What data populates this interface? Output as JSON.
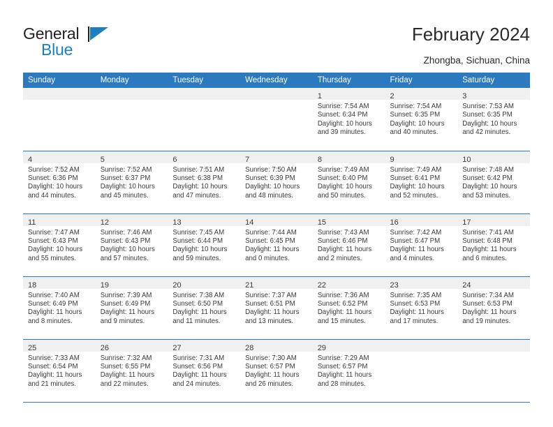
{
  "brand": {
    "name_top": "General",
    "name_bottom": "Blue",
    "accent_color": "#1b7fc4"
  },
  "header": {
    "title": "February 2024",
    "subtitle": "Zhongba, Sichuan, China",
    "header_bg": "#2b7ac0",
    "cell_band_bg": "#f0f0f0"
  },
  "weekdays": [
    "Sunday",
    "Monday",
    "Tuesday",
    "Wednesday",
    "Thursday",
    "Friday",
    "Saturday"
  ],
  "labels": {
    "sunrise_prefix": "Sunrise:",
    "sunset_prefix": "Sunset:",
    "daylight_prefix": "Daylight:"
  },
  "weeks": [
    [
      {
        "day": "",
        "lines": [
          "",
          "",
          "",
          ""
        ]
      },
      {
        "day": "",
        "lines": [
          "",
          "",
          "",
          ""
        ]
      },
      {
        "day": "",
        "lines": [
          "",
          "",
          "",
          ""
        ]
      },
      {
        "day": "",
        "lines": [
          "",
          "",
          "",
          ""
        ]
      },
      {
        "day": "1",
        "lines": [
          "Sunrise: 7:54 AM",
          "Sunset: 6:34 PM",
          "Daylight: 10 hours",
          "and 39 minutes."
        ]
      },
      {
        "day": "2",
        "lines": [
          "Sunrise: 7:54 AM",
          "Sunset: 6:35 PM",
          "Daylight: 10 hours",
          "and 40 minutes."
        ]
      },
      {
        "day": "3",
        "lines": [
          "Sunrise: 7:53 AM",
          "Sunset: 6:35 PM",
          "Daylight: 10 hours",
          "and 42 minutes."
        ]
      }
    ],
    [
      {
        "day": "4",
        "lines": [
          "Sunrise: 7:52 AM",
          "Sunset: 6:36 PM",
          "Daylight: 10 hours",
          "and 44 minutes."
        ]
      },
      {
        "day": "5",
        "lines": [
          "Sunrise: 7:52 AM",
          "Sunset: 6:37 PM",
          "Daylight: 10 hours",
          "and 45 minutes."
        ]
      },
      {
        "day": "6",
        "lines": [
          "Sunrise: 7:51 AM",
          "Sunset: 6:38 PM",
          "Daylight: 10 hours",
          "and 47 minutes."
        ]
      },
      {
        "day": "7",
        "lines": [
          "Sunrise: 7:50 AM",
          "Sunset: 6:39 PM",
          "Daylight: 10 hours",
          "and 48 minutes."
        ]
      },
      {
        "day": "8",
        "lines": [
          "Sunrise: 7:49 AM",
          "Sunset: 6:40 PM",
          "Daylight: 10 hours",
          "and 50 minutes."
        ]
      },
      {
        "day": "9",
        "lines": [
          "Sunrise: 7:49 AM",
          "Sunset: 6:41 PM",
          "Daylight: 10 hours",
          "and 52 minutes."
        ]
      },
      {
        "day": "10",
        "lines": [
          "Sunrise: 7:48 AM",
          "Sunset: 6:42 PM",
          "Daylight: 10 hours",
          "and 53 minutes."
        ]
      }
    ],
    [
      {
        "day": "11",
        "lines": [
          "Sunrise: 7:47 AM",
          "Sunset: 6:43 PM",
          "Daylight: 10 hours",
          "and 55 minutes."
        ]
      },
      {
        "day": "12",
        "lines": [
          "Sunrise: 7:46 AM",
          "Sunset: 6:43 PM",
          "Daylight: 10 hours",
          "and 57 minutes."
        ]
      },
      {
        "day": "13",
        "lines": [
          "Sunrise: 7:45 AM",
          "Sunset: 6:44 PM",
          "Daylight: 10 hours",
          "and 59 minutes."
        ]
      },
      {
        "day": "14",
        "lines": [
          "Sunrise: 7:44 AM",
          "Sunset: 6:45 PM",
          "Daylight: 11 hours",
          "and 0 minutes."
        ]
      },
      {
        "day": "15",
        "lines": [
          "Sunrise: 7:43 AM",
          "Sunset: 6:46 PM",
          "Daylight: 11 hours",
          "and 2 minutes."
        ]
      },
      {
        "day": "16",
        "lines": [
          "Sunrise: 7:42 AM",
          "Sunset: 6:47 PM",
          "Daylight: 11 hours",
          "and 4 minutes."
        ]
      },
      {
        "day": "17",
        "lines": [
          "Sunrise: 7:41 AM",
          "Sunset: 6:48 PM",
          "Daylight: 11 hours",
          "and 6 minutes."
        ]
      }
    ],
    [
      {
        "day": "18",
        "lines": [
          "Sunrise: 7:40 AM",
          "Sunset: 6:49 PM",
          "Daylight: 11 hours",
          "and 8 minutes."
        ]
      },
      {
        "day": "19",
        "lines": [
          "Sunrise: 7:39 AM",
          "Sunset: 6:49 PM",
          "Daylight: 11 hours",
          "and 9 minutes."
        ]
      },
      {
        "day": "20",
        "lines": [
          "Sunrise: 7:38 AM",
          "Sunset: 6:50 PM",
          "Daylight: 11 hours",
          "and 11 minutes."
        ]
      },
      {
        "day": "21",
        "lines": [
          "Sunrise: 7:37 AM",
          "Sunset: 6:51 PM",
          "Daylight: 11 hours",
          "and 13 minutes."
        ]
      },
      {
        "day": "22",
        "lines": [
          "Sunrise: 7:36 AM",
          "Sunset: 6:52 PM",
          "Daylight: 11 hours",
          "and 15 minutes."
        ]
      },
      {
        "day": "23",
        "lines": [
          "Sunrise: 7:35 AM",
          "Sunset: 6:53 PM",
          "Daylight: 11 hours",
          "and 17 minutes."
        ]
      },
      {
        "day": "24",
        "lines": [
          "Sunrise: 7:34 AM",
          "Sunset: 6:53 PM",
          "Daylight: 11 hours",
          "and 19 minutes."
        ]
      }
    ],
    [
      {
        "day": "25",
        "lines": [
          "Sunrise: 7:33 AM",
          "Sunset: 6:54 PM",
          "Daylight: 11 hours",
          "and 21 minutes."
        ]
      },
      {
        "day": "26",
        "lines": [
          "Sunrise: 7:32 AM",
          "Sunset: 6:55 PM",
          "Daylight: 11 hours",
          "and 22 minutes."
        ]
      },
      {
        "day": "27",
        "lines": [
          "Sunrise: 7:31 AM",
          "Sunset: 6:56 PM",
          "Daylight: 11 hours",
          "and 24 minutes."
        ]
      },
      {
        "day": "28",
        "lines": [
          "Sunrise: 7:30 AM",
          "Sunset: 6:57 PM",
          "Daylight: 11 hours",
          "and 26 minutes."
        ]
      },
      {
        "day": "29",
        "lines": [
          "Sunrise: 7:29 AM",
          "Sunset: 6:57 PM",
          "Daylight: 11 hours",
          "and 28 minutes."
        ]
      },
      {
        "day": "",
        "lines": [
          "",
          "",
          "",
          ""
        ]
      },
      {
        "day": "",
        "lines": [
          "",
          "",
          "",
          ""
        ]
      }
    ]
  ]
}
